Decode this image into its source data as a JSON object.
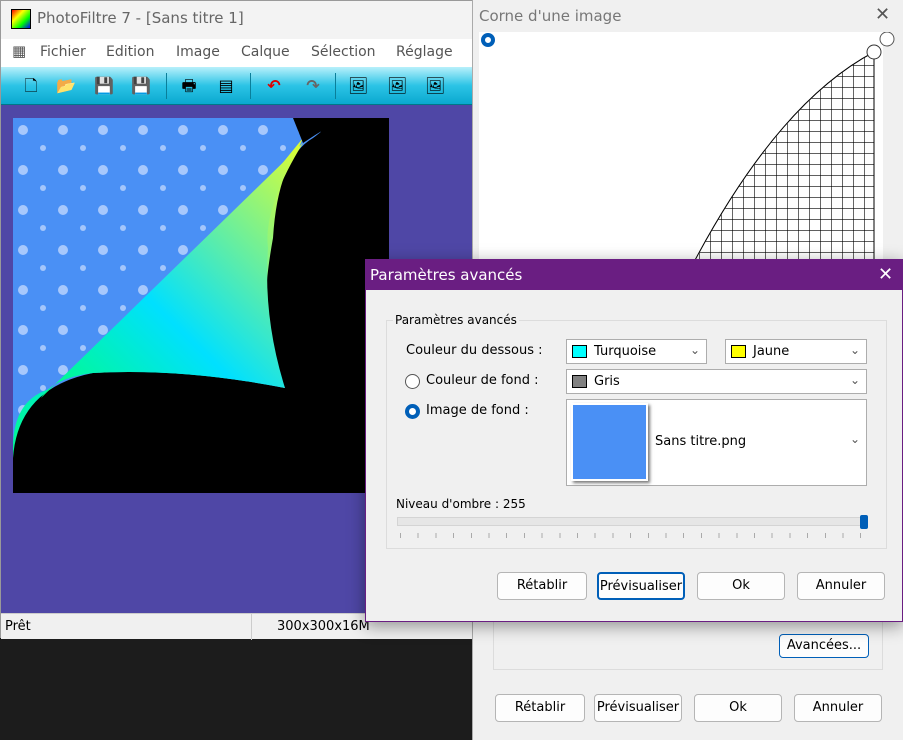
{
  "main_window": {
    "title": "PhotoFiltre 7 - [Sans titre 1]",
    "menu": [
      "Fichier",
      "Edition",
      "Image",
      "Calque",
      "Sélection",
      "Réglage"
    ],
    "toolbar": [
      "new-file-icon",
      "open-folder-icon",
      "save-icon",
      "save-as-icon",
      "print-icon",
      "scan-icon",
      "undo-icon",
      "redo-icon",
      "image-copy-icon",
      "transparent-image-icon",
      "duplicate-image-icon"
    ],
    "status": {
      "text": "Prêt",
      "size": "300x300x16M"
    }
  },
  "corner_dialog": {
    "title": "Corne d'une image",
    "advanced_button": "Avancées...",
    "buttons": {
      "reset": "Rétablir",
      "preview": "Prévisualiser",
      "ok": "Ok",
      "cancel": "Annuler"
    }
  },
  "advanced_dialog": {
    "title": "Paramètres avancés",
    "group_label": "Paramètres avancés",
    "underside_label": "Couleur du dessous :",
    "underside_color1": {
      "label": "Turquoise",
      "color": "#00ffff"
    },
    "underside_color2": {
      "label": "Jaune",
      "color": "#ffff00"
    },
    "bg_color_label": "Couleur de fond :",
    "bg_color": {
      "label": "Gris",
      "color": "#808080"
    },
    "bg_color_selected": false,
    "bg_image_label": "Image de fond :",
    "bg_image": "Sans titre.png",
    "bg_image_selected": true,
    "shadow_label": "Niveau d'ombre : 255",
    "shadow_value": 255,
    "shadow_max": 255,
    "buttons": {
      "reset": "Rétablir",
      "preview": "Prévisualiser",
      "ok": "Ok",
      "cancel": "Annuler"
    }
  }
}
